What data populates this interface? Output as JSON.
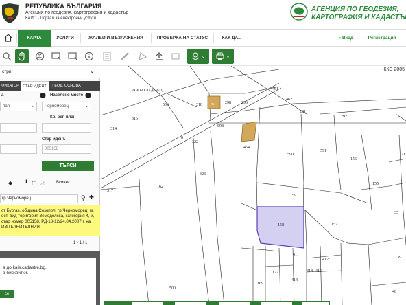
{
  "header": {
    "republic": "РЕПУБЛИКА БЪЛГАРИЯ",
    "agency_line": "Агенция по геодезия, картография и кадастър",
    "portal_line": "КАИС - Портал за електронни услуги",
    "agency_logo_text1": "АГЕНЦИЯ ПО ГЕОДЕЗИЯ,",
    "agency_logo_text2": "КАРТОГРАФИЯ И КАДАСТЪР"
  },
  "nav": {
    "home_icon": "home-icon",
    "items": [
      "КАРТА",
      "УСЛУГИ",
      "ЖАЛБИ И ВЪЗРАЖЕНИЯ",
      "ПРОВЕРКА НА СТАТУС",
      "КАК ДА..."
    ],
    "login": "› Вход",
    "register": "› Регистрация"
  },
  "panel": {
    "layer_select": "стри",
    "tabs": [
      "ФИКАТОР",
      "СТАР ИДЕНТ.",
      "ГЕОД. ОСНОВА"
    ],
    "label_region": "а",
    "label_settlement": "Населено място",
    "region_value": "пол",
    "settlement_value": "Черноморец",
    "label_plan": "Кв. рег. план",
    "label_old_id": "Стар идент.",
    "old_id_placeholder": "005158",
    "search_button": "ТЪРСИ",
    "all_label": "Всички",
    "search_result_input": "гр.Черноморец",
    "result_text": "ст Бургас, община Созопол, гр.Черноморец, м. ост, вид територия Земеделска, категория 4, и, стар номер 005158, РД-18-12/24.04.2007 г. на ИЗПЪЛНИТЕЛНИЯ",
    "pagination": "1 - 1 / 1",
    "cookie_line1": "а до kais.cadastre.bg,",
    "cookie_line2": "а бисквитки.",
    "cookie_btn": "се"
  },
  "map": {
    "crs": "ККС 2005",
    "parcels": [
      "461",
      "506",
      "318",
      "298",
      "296",
      "462",
      "281",
      "292",
      "314",
      "315",
      "698",
      "6",
      "322",
      "454",
      "590",
      "591",
      "156",
      "21",
      "317",
      "162",
      "323",
      "159",
      "155",
      "158",
      "157",
      "35",
      "411",
      "412",
      "39",
      "172",
      "414",
      "418",
      "415",
      "40",
      "169",
      "500"
    ],
    "road_label": "РАНОВ КЛАДЕНЕЦ",
    "building_label": "ПБ"
  },
  "colors": {
    "brand_green": "#2e7d32",
    "highlight": "#d3d0f2",
    "result_bg": "#fdf87e"
  }
}
